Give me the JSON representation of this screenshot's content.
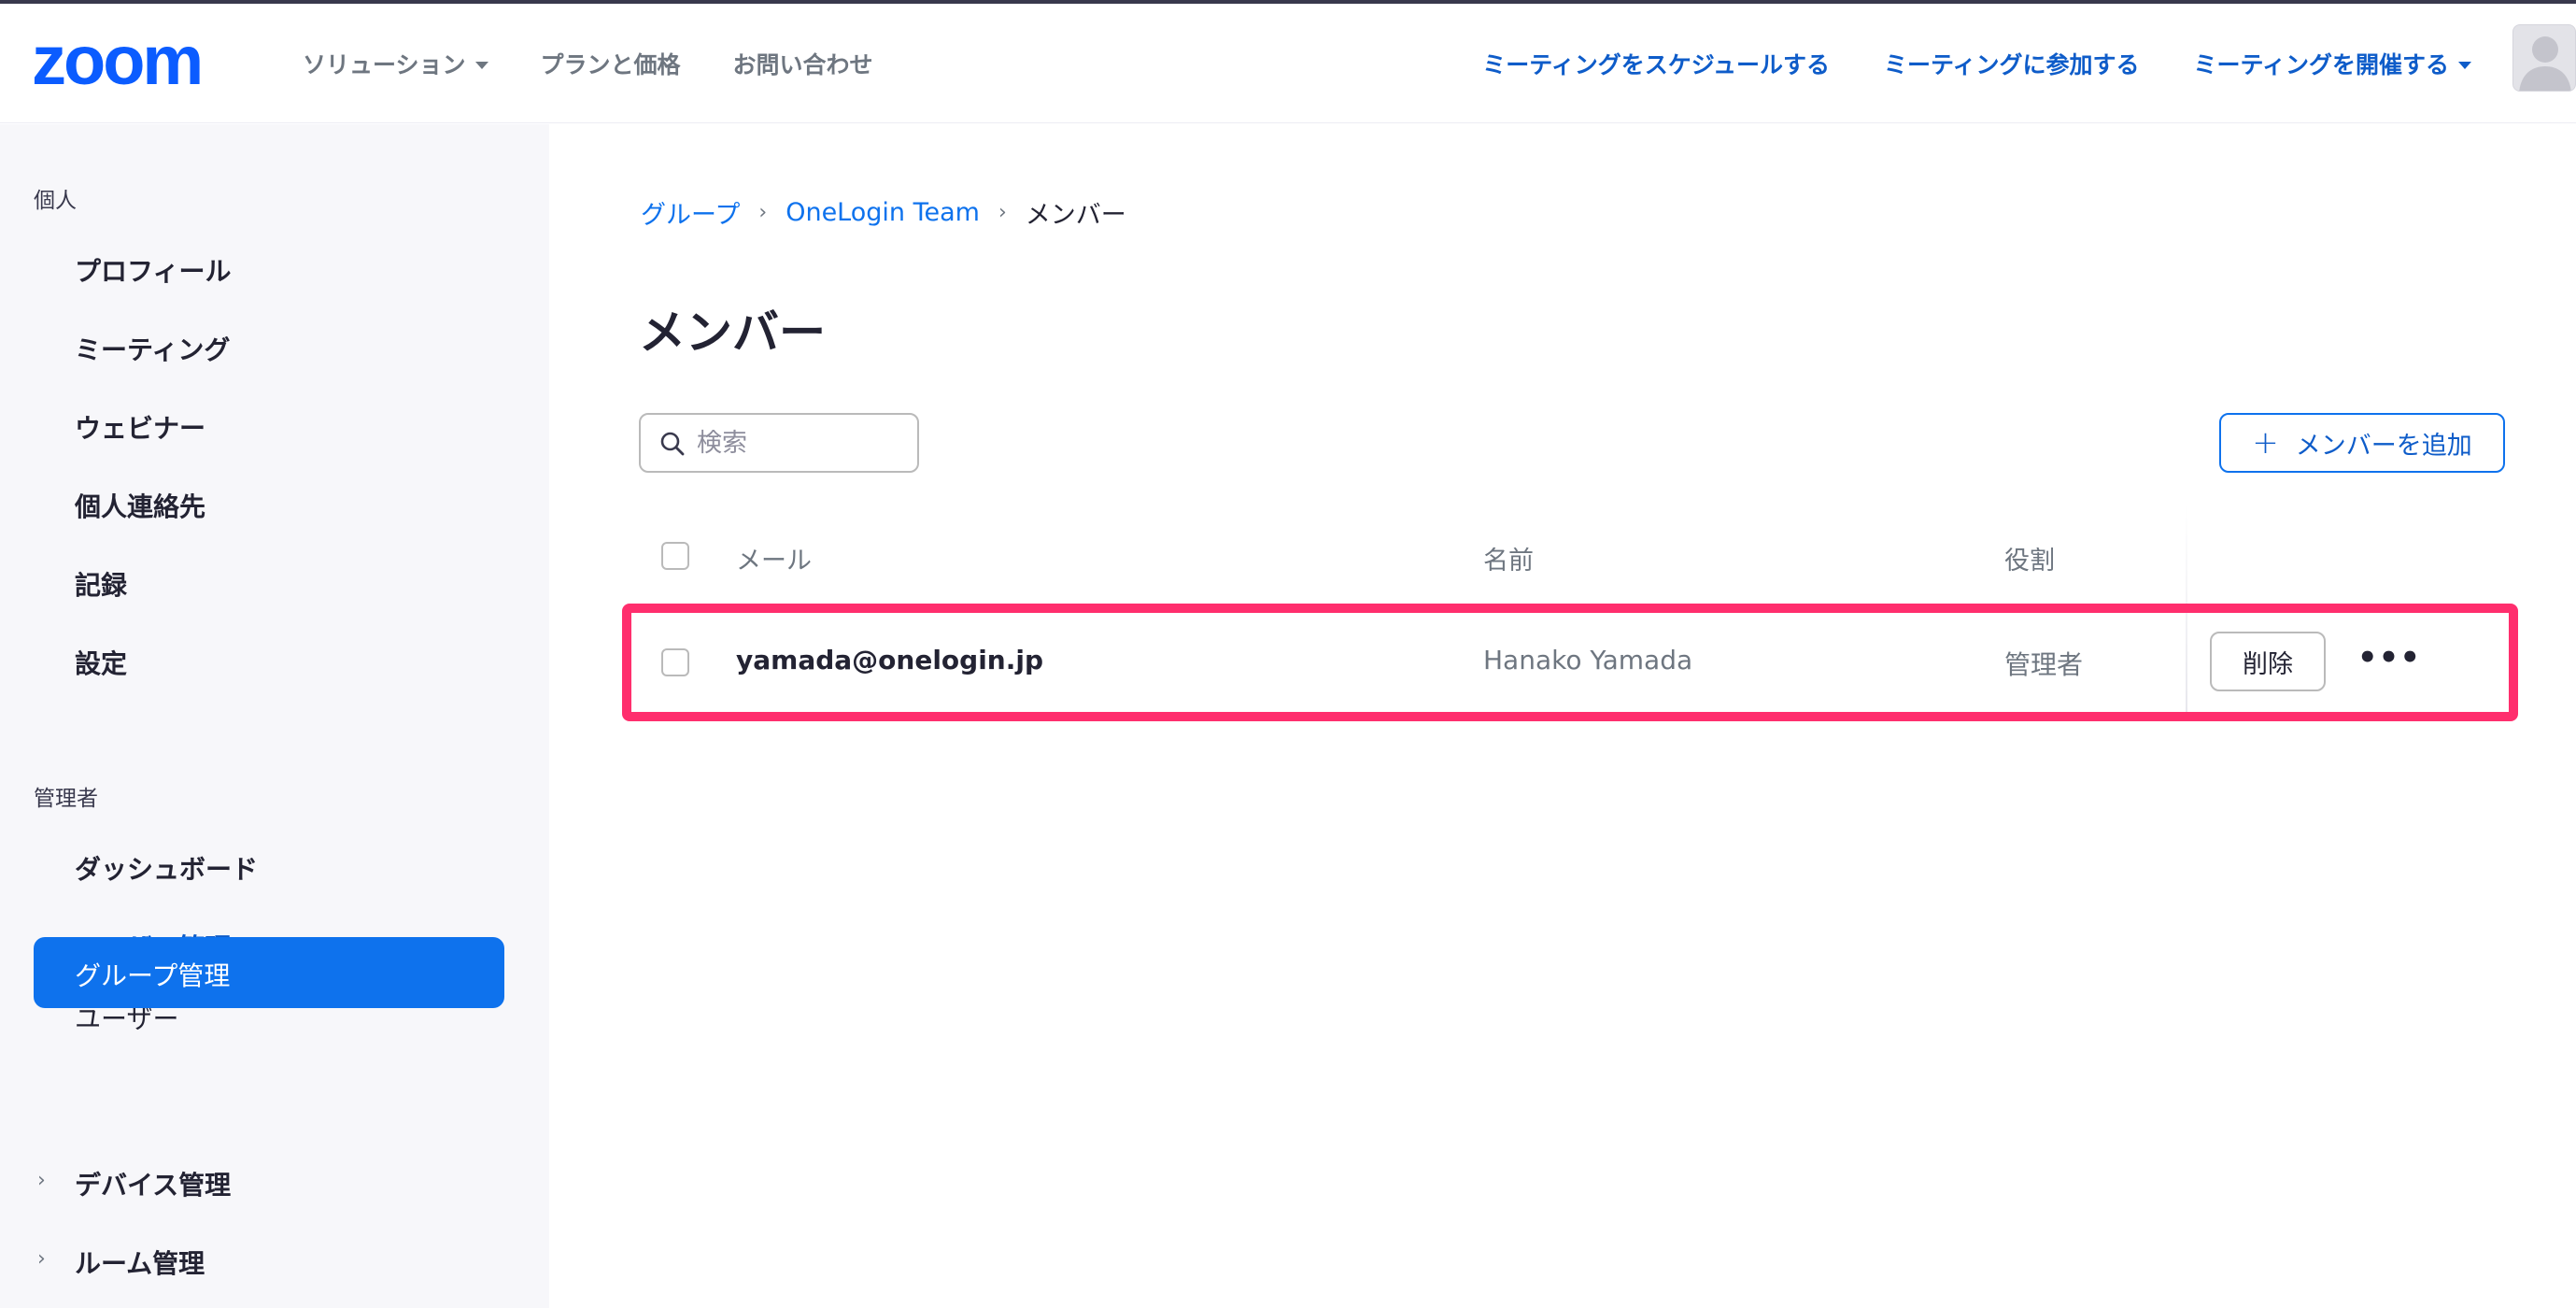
{
  "header": {
    "logo_text": "zoom",
    "nav_left": [
      {
        "label": "ソリューション",
        "dropdown": true
      },
      {
        "label": "プランと価格",
        "dropdown": false
      },
      {
        "label": "お問い合わせ",
        "dropdown": false
      }
    ],
    "nav_right": [
      {
        "label": "ミーティングをスケジュールする",
        "dropdown": false
      },
      {
        "label": "ミーティングに参加する",
        "dropdown": false
      },
      {
        "label": "ミーティングを開催する",
        "dropdown": true
      }
    ]
  },
  "sidebar": {
    "personal_label": "個人",
    "personal_items": [
      "プロフィール",
      "ミーティング",
      "ウェビナー",
      "個人連絡先",
      "記録",
      "設定"
    ],
    "admin_label": "管理者",
    "dashboard": "ダッシュボード",
    "user_mgmt": "ユーザー管理",
    "users": "ユーザー",
    "group_mgmt": "グループ管理",
    "device_mgmt": "デバイス管理",
    "room_mgmt": "ルーム管理"
  },
  "main": {
    "breadcrumb": [
      "グループ",
      "OneLogin Team",
      "メンバー"
    ],
    "title": "メンバー",
    "search_placeholder": "検索",
    "add_member_label": "メンバーを追加",
    "table": {
      "headers": [
        "メール",
        "名前",
        "役割"
      ],
      "rows": [
        {
          "email": "yamada@onelogin.jp",
          "name": "Hanako Yamada",
          "role": "管理者",
          "delete_label": "削除"
        }
      ]
    }
  },
  "colors": {
    "brand_blue": "#0e72ed",
    "link_blue": "#0e5cc9",
    "highlight": "#ff2e6d"
  }
}
